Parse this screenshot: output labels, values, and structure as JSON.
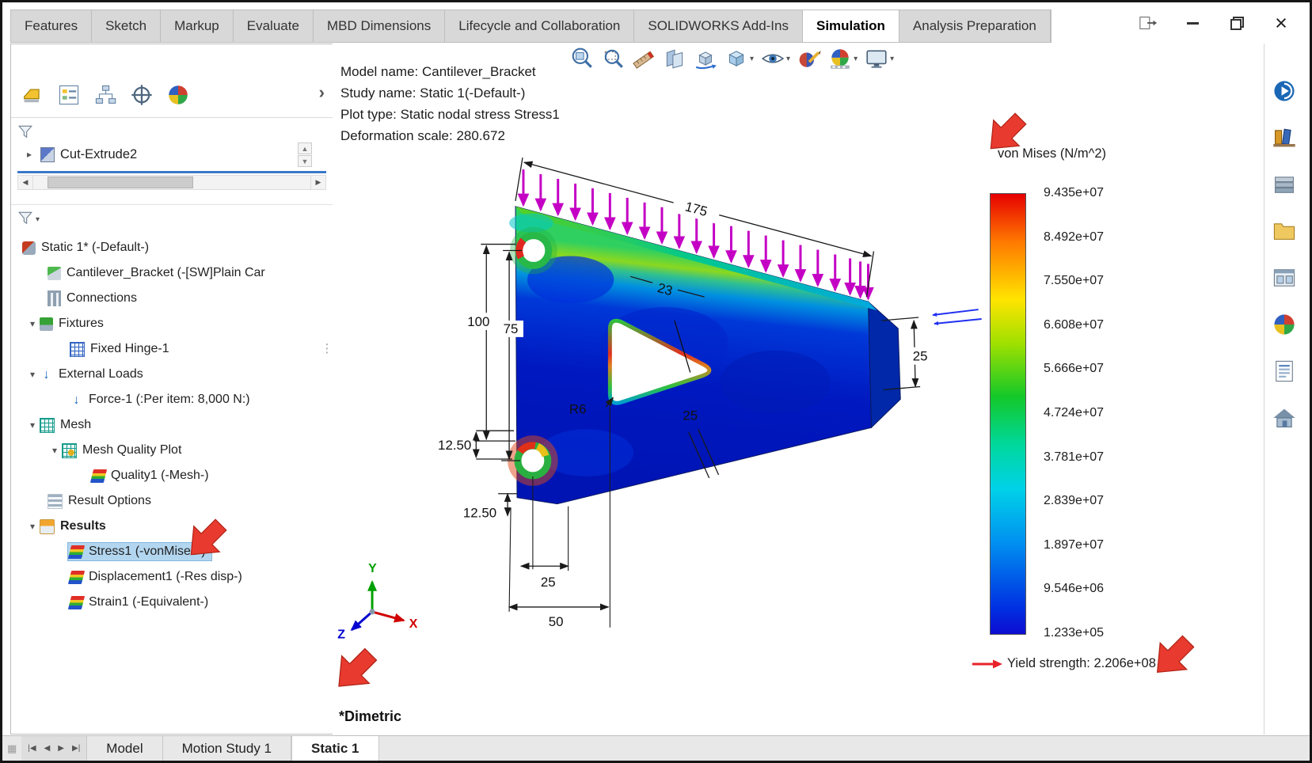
{
  "ribbon": {
    "tabs": [
      "Features",
      "Sketch",
      "Markup",
      "Evaluate",
      "MBD Dimensions",
      "Lifecycle and Collaboration",
      "SOLIDWORKS Add-Ins",
      "Simulation",
      "Analysis Preparation"
    ],
    "active_tab": "Simulation"
  },
  "window_controls": {
    "icons": [
      "ribbon-flyout",
      "minimize",
      "restore",
      "close"
    ]
  },
  "feature_pane": {
    "flyout_item": "Cut-Extrude2",
    "tree": [
      {
        "label": "Static 1* (-Default-)",
        "icon": "simulation-study-icon"
      },
      {
        "label": "Cantilever_Bracket (-[SW]Plain Car",
        "icon": "part-icon"
      },
      {
        "label": "Connections",
        "icon": "connections-icon"
      },
      {
        "label": "Fixtures",
        "icon": "fixtures-icon"
      },
      {
        "label": "Fixed Hinge-1",
        "icon": "fixed-hinge-icon"
      },
      {
        "label": "External Loads",
        "icon": "external-loads-icon"
      },
      {
        "label": "Force-1 (:Per item: 8,000 N:)",
        "icon": "force-icon"
      },
      {
        "label": "Mesh",
        "icon": "mesh-icon"
      },
      {
        "label": "Mesh Quality Plot",
        "icon": "mesh-quality-plot-icon"
      },
      {
        "label": "Quality1 (-Mesh-)",
        "icon": "quality-plot-icon"
      },
      {
        "label": "Result Options",
        "icon": "result-options-icon"
      },
      {
        "label": "Results",
        "icon": "results-folder-icon"
      },
      {
        "label": "Stress1 (-vonMises-)",
        "icon": "stress-plot-icon",
        "selected": true
      },
      {
        "label": "Displacement1 (-Res disp-)",
        "icon": "displacement-plot-icon"
      },
      {
        "label": "Strain1 (-Equivalent-)",
        "icon": "strain-plot-icon"
      }
    ]
  },
  "hud_icons": [
    "zoom-to-fit",
    "zoom-to-area",
    "measure",
    "section-view",
    "3d-drawing-view",
    "view-orientation",
    "hide-show-items",
    "edit-appearance",
    "apply-scene",
    "view-settings"
  ],
  "viewport": {
    "model_info": [
      "Model name: Cantilever_Bracket",
      "Study name: Static 1(-Default-)",
      "Plot type: Static nodal stress Stress1",
      "Deformation scale: 280.672"
    ],
    "view_orientation_label": "*Dimetric",
    "triad": {
      "x": "X",
      "y": "Y",
      "z": "Z"
    },
    "dimensions": {
      "top_width": "175",
      "top_edge": "23",
      "left_height": "100",
      "hole_span": "75",
      "right_depth": "25",
      "fillet_radius": "R6",
      "offset_upper": "12.50",
      "offset_lower": "12.50",
      "mid_depth": "25",
      "hole_pitch": "25",
      "base_width": "50"
    }
  },
  "legend": {
    "title": "von Mises (N/m^2)",
    "ticks": [
      "9.435e+07",
      "8.492e+07",
      "7.550e+07",
      "6.608e+07",
      "5.666e+07",
      "4.724e+07",
      "3.781e+07",
      "2.839e+07",
      "1.897e+07",
      "9.546e+06",
      "1.233e+05"
    ],
    "yield": "Yield strength: 2.206e+08"
  },
  "task_pane_icons": [
    "solidworks-resources",
    "design-library",
    "toolbox",
    "file-explorer",
    "view-palette",
    "appearances-scenes",
    "custom-properties",
    "welcome-home"
  ],
  "bottom_bar": {
    "tabs": [
      "Model",
      "Motion Study 1",
      "Static 1"
    ],
    "active_tab": "Static 1"
  },
  "colors": {
    "selection_highlight": "#b3d6f0",
    "annotation_arrow": "#e83a2e",
    "force_arrows": "#c400c4",
    "legend_top": "#e60000",
    "legend_bottom": "#0d0dd0"
  }
}
